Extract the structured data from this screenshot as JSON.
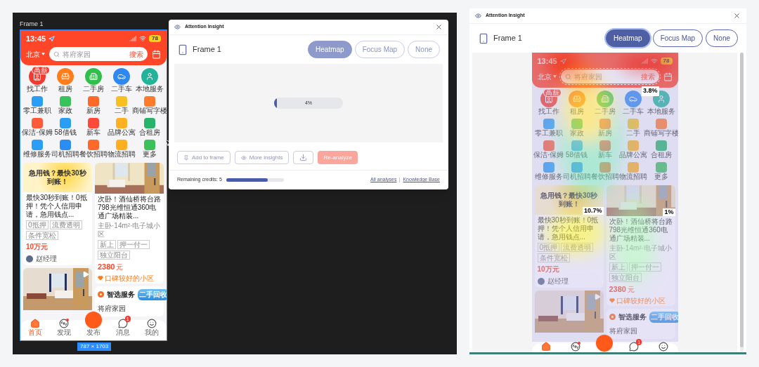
{
  "canvas": {
    "frame_label": "Frame 1",
    "size_tag": "787 × 1703",
    "phone": {
      "time": "13:45",
      "battery": "78",
      "city": "北京",
      "search_placeholder": "将府家园",
      "search_button": "搜索",
      "heatmap": false,
      "main_services": [
        {
          "label": "找工作",
          "badge": "高薪"
        },
        {
          "label": "租房"
        },
        {
          "label": "二手房"
        },
        {
          "label": "二手车"
        },
        {
          "label": "本地服务"
        }
      ],
      "services": [
        "零工兼职",
        "家政",
        "新房",
        "二手",
        "商铺写字楼",
        "保洁·保姆",
        "58借钱",
        "新车",
        "品牌公寓",
        "合租房",
        "维修服务",
        "司机招聘",
        "餐饮招聘",
        "物流招聘",
        "更多"
      ],
      "loan_card": {
        "banner": "急用钱？最快30秒到账！",
        "title": "最快30秒到账！0抵押！凭个人信用申请，急用钱点...",
        "tags": [
          "0抵押",
          "流费透明",
          "条件宽松"
        ],
        "price": "10万元",
        "agent": "赵经理"
      },
      "room_card": {
        "title": "次卧！酒仙桥将台路798光维恒通360电通广场精装...",
        "meta": "主卧·14m²·电子城小区",
        "tags": [
          "新上",
          "押一付一",
          "独立阳台"
        ],
        "price": "2380",
        "unit": "元",
        "note": "口碑较好的小区"
      },
      "promo": "二手回收",
      "service_card": {
        "title": "智选服务",
        "row": "将府家园"
      },
      "tabs": [
        {
          "kind": "home",
          "label": "首页",
          "selected": true
        },
        {
          "kind": "discover",
          "label": "发现",
          "selected": false,
          "dot": true
        },
        {
          "kind": "publish",
          "label": "发布",
          "selected": false
        },
        {
          "kind": "message",
          "label": "消息",
          "selected": false,
          "badge": "1"
        },
        {
          "kind": "me",
          "label": "我的",
          "selected": false
        }
      ]
    }
  },
  "plugin_panel": {
    "title": "Attention Insight",
    "frame": "Frame 1",
    "disabled": true,
    "tabs": [
      {
        "label": "Heatmap",
        "selected": true
      },
      {
        "label": "Focus Map",
        "selected": false
      },
      {
        "label": "None",
        "selected": false
      }
    ],
    "progress": {
      "level": 0.04,
      "reading": "4%"
    },
    "buttons": [
      {
        "kind": "pin",
        "label": "Add to frame"
      },
      {
        "kind": "eye",
        "label": "More insights"
      },
      {
        "kind": "download"
      },
      {
        "kind": "primary",
        "label": "Re-analyze"
      }
    ],
    "credits": {
      "label": "Remaining credits: 5",
      "level": 0.72
    },
    "links": [
      "All analyses",
      "Knowledge Base"
    ]
  },
  "result_panel": {
    "title": "Attention Insight",
    "frame": "Frame 1",
    "disabled": false,
    "tabs": [
      {
        "label": "Heatmap",
        "selected": true
      },
      {
        "label": "Focus Map",
        "selected": false
      },
      {
        "label": "None",
        "selected": false
      }
    ],
    "phone": {
      "time": "13:45",
      "battery": "78",
      "city": "北京",
      "search_placeholder": "将府家园",
      "search_button": "搜索",
      "heatmap": true,
      "search_hotspot": "3.8%",
      "main_services": [
        {
          "label": "找工作",
          "badge": "高薪"
        },
        {
          "label": "租房"
        },
        {
          "label": "二手房"
        },
        {
          "label": "二手车"
        },
        {
          "label": "本地服务"
        }
      ],
      "services": [
        "零工兼职",
        "家政",
        "新房",
        "二手",
        "商铺写字楼",
        "保洁·保姆",
        "58借钱",
        "新车",
        "品牌公寓",
        "合租房",
        "维修服务",
        "司机招聘",
        "餐饮招聘",
        "物流招聘",
        "更多"
      ],
      "loan_card": {
        "banner": "急用钱？最快30秒到账！",
        "hotspot": "10.7%",
        "title": "最快30秒到账！0抵押！凭个人信用申请，急用钱点...",
        "tags": [
          "0抵押",
          "流费透明",
          "条件宽松"
        ],
        "price": "10万元",
        "agent": "赵经理"
      },
      "room_card": {
        "hotspot": "1%",
        "title": "次卧！酒仙桥将台路798光维恒通360电通广场精装...",
        "meta": "主卧·14m²·电子城小区",
        "tags": [
          "新上",
          "押一付一",
          "独立阳台"
        ],
        "price": "2380",
        "unit": "元",
        "note": "口碑较好的小区"
      },
      "promo": "二手回收",
      "service_card": {
        "title": "智选服务",
        "row": "将府家园"
      },
      "tabs": [
        {
          "kind": "home",
          "selected": true
        },
        {
          "kind": "discover",
          "selected": false,
          "dot": true
        },
        {
          "kind": "publish",
          "selected": false
        },
        {
          "kind": "message",
          "selected": false,
          "badge": "1"
        },
        {
          "kind": "me",
          "selected": false
        }
      ]
    }
  }
}
